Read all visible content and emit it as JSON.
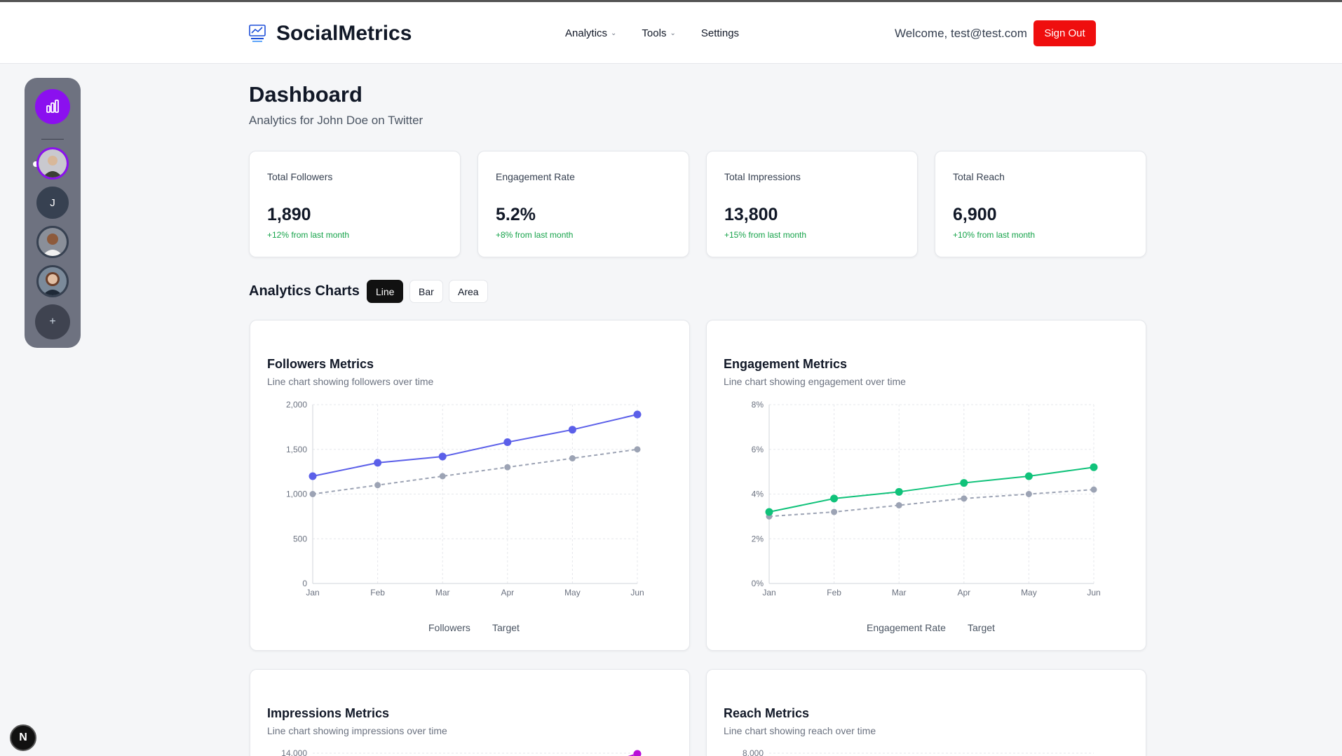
{
  "header": {
    "brand": "SocialMetrics",
    "nav": [
      {
        "label": "Analytics",
        "dropdown": true
      },
      {
        "label": "Tools",
        "dropdown": true
      },
      {
        "label": "Settings",
        "dropdown": false
      }
    ],
    "welcome": "Welcome, test@test.com",
    "sign_out": "Sign Out"
  },
  "sidebar": {
    "letter_avatar": "J",
    "add_label": "+",
    "accent": "#8b10ef"
  },
  "corner_badge": "N",
  "page": {
    "title": "Dashboard",
    "subtitle": "Analytics for John Doe on Twitter"
  },
  "stats": [
    {
      "label": "Total Followers",
      "value": "1,890",
      "delta": "+12% from last month"
    },
    {
      "label": "Engagement Rate",
      "value": "5.2%",
      "delta": "+8% from last month"
    },
    {
      "label": "Total Impressions",
      "value": "13,800",
      "delta": "+15% from last month"
    },
    {
      "label": "Total Reach",
      "value": "6,900",
      "delta": "+10% from last month"
    }
  ],
  "charts_section": {
    "title": "Analytics Charts",
    "toggles": [
      "Line",
      "Bar",
      "Area"
    ],
    "active": "Line"
  },
  "cards": [
    {
      "title": "Followers Metrics",
      "subtitle": "Line chart showing followers over time"
    },
    {
      "title": "Engagement Metrics",
      "subtitle": "Line chart showing engagement over time"
    },
    {
      "title": "Impressions Metrics",
      "subtitle": "Line chart showing impressions over time"
    },
    {
      "title": "Reach Metrics",
      "subtitle": "Line chart showing reach over time"
    }
  ],
  "chart_data": [
    {
      "type": "line",
      "categories": [
        "Jan",
        "Feb",
        "Mar",
        "Apr",
        "May",
        "Jun"
      ],
      "yticks": [
        "0",
        "500",
        "1,000",
        "1,500",
        "2,000"
      ],
      "ylim": [
        0,
        2000
      ],
      "series": [
        {
          "name": "Followers",
          "values": [
            1200,
            1350,
            1420,
            1580,
            1720,
            1890
          ],
          "color": "#5b5fe9",
          "dashed": false
        },
        {
          "name": "Target",
          "values": [
            1000,
            1100,
            1200,
            1300,
            1400,
            1500
          ],
          "color": "#9ca3b4",
          "dashed": true
        }
      ]
    },
    {
      "type": "line",
      "categories": [
        "Jan",
        "Feb",
        "Mar",
        "Apr",
        "May",
        "Jun"
      ],
      "yticks": [
        "0%",
        "2%",
        "4%",
        "6%",
        "8%"
      ],
      "ylim": [
        0,
        8
      ],
      "series": [
        {
          "name": "Engagement Rate",
          "values": [
            3.2,
            3.8,
            4.1,
            4.5,
            4.8,
            5.2
          ],
          "color": "#10c27a",
          "dashed": false
        },
        {
          "name": "Target",
          "values": [
            3.0,
            3.2,
            3.5,
            3.8,
            4.0,
            4.2
          ],
          "color": "#9ca3b4",
          "dashed": true
        }
      ]
    },
    {
      "type": "line",
      "yticks": [
        "14,000"
      ],
      "ylim": [
        0,
        14000
      ],
      "series": [
        {
          "values": [
            13800
          ],
          "color": "#b80fd8"
        }
      ]
    },
    {
      "type": "line",
      "yticks": [
        "8,000"
      ],
      "ylim": [
        0,
        8000
      ]
    }
  ]
}
